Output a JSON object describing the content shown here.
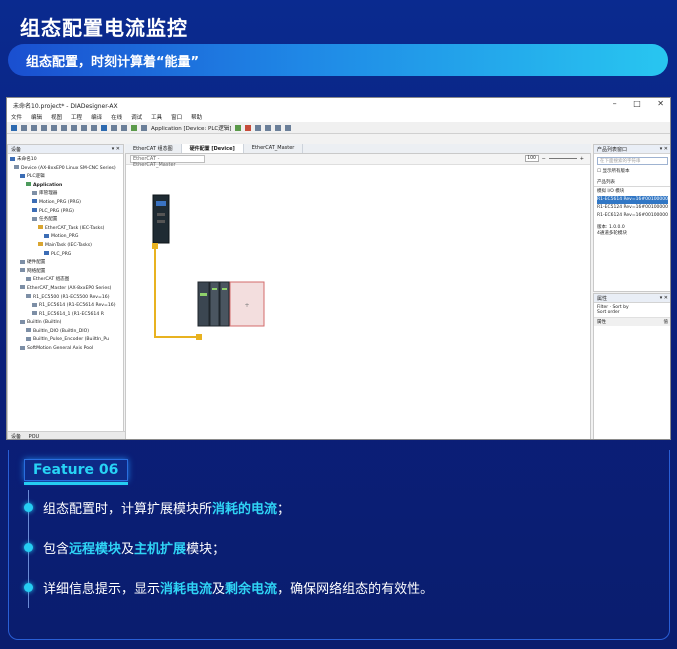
{
  "page": {
    "title": "组态配置电流监控",
    "subtitle": "组态配置，时刻计算着“能量”"
  },
  "app": {
    "window_title": "未命名10.project* - DIADesigner-AX",
    "menu": [
      "文件",
      "编辑",
      "视图",
      "工程",
      "编译",
      "在线",
      "调试",
      "工具",
      "窗口",
      "帮助"
    ],
    "toolbar_device": "Application [Device: PLC逻辑]",
    "device_panel_title": "设备",
    "tree": [
      "未命名10",
      "Device (AX-8xxEP0 Linux SM-CNC Series)",
      "PLC逻辑",
      "Application",
      "库管理器",
      "Motion_PRG (PRG)",
      "PLC_PRG (PRG)",
      "任务配置",
      "EtherCAT_Task (IEC-Tasks)",
      "Motion_PRG",
      "MainTask (IEC-Tasks)",
      "PLC_PRG",
      "硬件配置",
      "网络配置",
      "EtherCAT 组态图",
      "EtherCAT_Master (AX-8xxEP0 Series)",
      "R1_EC5500 (R1-EC5500 Rev=16)",
      "R1_EC5614 (R1-EC5614 Rev=16)",
      "R1_EC5614_1 (R1-EC5614 R",
      "BuiltIn (BuiltIn)",
      "BuiltIn_DIO (BuiltIn_DIO)",
      "BuiltIn_Pulse_Encoder (BuiltIn_Pu",
      "SoftMotion General Axis Pool"
    ],
    "bottom_tabs": [
      "设备",
      "POU"
    ],
    "tabs": [
      "EtherCAT 组态图",
      "硬件配置 [Device]",
      "EtherCAT_Master"
    ],
    "canvas_dropdown": "EtherCAT - EtherCAT_Master",
    "zoom_value": "100",
    "props_title": "产品列表窗口",
    "props_search_placeholder": "在下面搜索的字符串",
    "props_checkbox": "显示所有版本",
    "props_tab": "产品列表",
    "props_list": [
      "模拟 I/O 模块",
      "R1-EC5614 Rev=16#00100000",
      "R1-EC5124 Rev=16#00100000",
      "R1-EC6124 Rev=16#00100000"
    ],
    "props_info": [
      "版本: 1.0.0.0",
      "4通道多轮模块"
    ],
    "attr_title": "属性",
    "attr_toolbar": [
      "Filter",
      "Sort by",
      "Sort order"
    ],
    "attr_columns": [
      "属性",
      "值"
    ],
    "add_slot_label": "+"
  },
  "feature": {
    "tag": "Feature 06",
    "items": [
      {
        "parts": [
          [
            "组态配置时，计算扩展模块所",
            false
          ],
          [
            "消耗的电流",
            true
          ],
          [
            "；",
            false
          ]
        ]
      },
      {
        "parts": [
          [
            "包含",
            false
          ],
          [
            "远程模块",
            true
          ],
          [
            "及",
            false
          ],
          [
            "主机扩展",
            true
          ],
          [
            "模块；",
            false
          ]
        ]
      },
      {
        "parts": [
          [
            "详细信息提示，显示",
            false
          ],
          [
            "消耗电流",
            true
          ],
          [
            "及",
            false
          ],
          [
            "剩余电流",
            true
          ],
          [
            "，确保网络组态的有效性。",
            false
          ]
        ]
      }
    ]
  }
}
